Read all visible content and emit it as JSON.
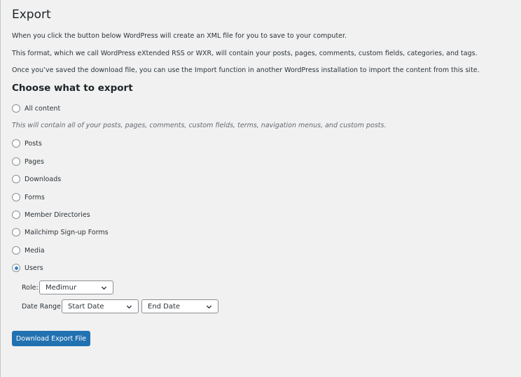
{
  "page": {
    "title": "Export",
    "paragraphs": [
      "When you click the button below WordPress will create an XML file for you to save to your computer.",
      "This format, which we call WordPress eXtended RSS or WXR, will contain your posts, pages, comments, custom fields, categories, and tags.",
      "Once you’ve saved the download file, you can use the Import function in another WordPress installation to import the content from this site."
    ]
  },
  "export_form": {
    "heading": "Choose what to export",
    "all_content_label": "All content",
    "all_content_description": "This will contain all of your posts, pages, comments, custom fields, terms, navigation menus, and custom posts.",
    "options": [
      {
        "label": "Posts",
        "checked": false
      },
      {
        "label": "Pages",
        "checked": false
      },
      {
        "label": "Downloads",
        "checked": false
      },
      {
        "label": "Forms",
        "checked": false
      },
      {
        "label": "Member Directories",
        "checked": false
      },
      {
        "label": "Mailchimp Sign-up Forms",
        "checked": false
      },
      {
        "label": "Media",
        "checked": false
      },
      {
        "label": "Users",
        "checked": true
      }
    ],
    "users_filters": {
      "role_label": "Role:",
      "role_value": "Međimur",
      "date_range_label": "Date Range:",
      "start_date_value": "Start Date",
      "end_date_value": "End Date"
    },
    "submit_label": "Download Export File"
  },
  "colors": {
    "background": "#f1f1f1",
    "primary_button": "#2271b1",
    "radio_checked": "#3582c4"
  }
}
